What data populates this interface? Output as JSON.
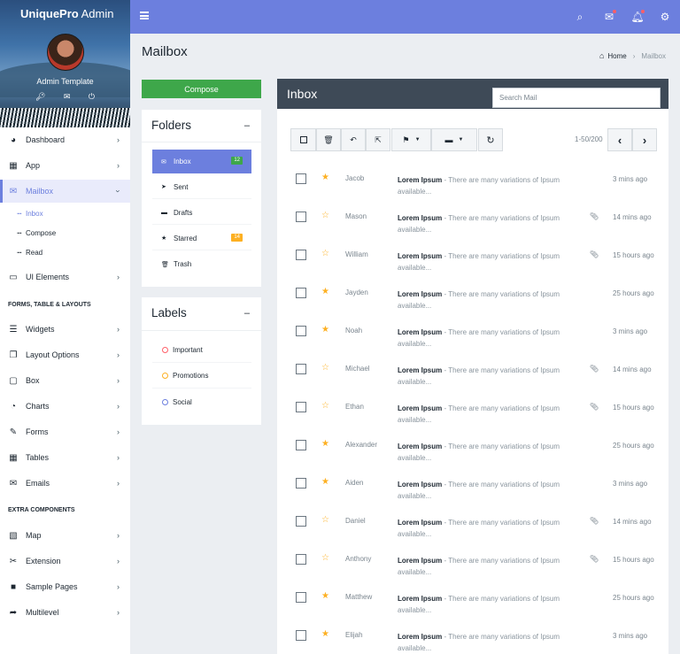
{
  "brand": {
    "bold": "UniquePro",
    "rest": " Admin"
  },
  "profile": {
    "name": "Admin Template"
  },
  "sidebar": {
    "items": [
      {
        "label": "Dashboard"
      },
      {
        "label": "App"
      },
      {
        "label": "Mailbox"
      },
      {
        "label": "UI Elements"
      },
      {
        "label": "Widgets"
      },
      {
        "label": "Layout Options"
      },
      {
        "label": "Box"
      },
      {
        "label": "Charts"
      },
      {
        "label": "Forms"
      },
      {
        "label": "Tables"
      },
      {
        "label": "Emails"
      },
      {
        "label": "Map"
      },
      {
        "label": "Extension"
      },
      {
        "label": "Sample Pages"
      },
      {
        "label": "Multilevel"
      }
    ],
    "mailbox_sub": [
      {
        "label": "Inbox"
      },
      {
        "label": "Compose"
      },
      {
        "label": "Read"
      }
    ],
    "headers": {
      "forms": "FORMS, TABLE & LAYOUTS",
      "extra": "EXTRA COMPONENTS"
    }
  },
  "page": {
    "title": "Mailbox"
  },
  "breadcrumb": {
    "home": "Home",
    "current": "Mailbox"
  },
  "compose": {
    "label": "Compose"
  },
  "folders": {
    "title": "Folders",
    "items": [
      {
        "label": "Inbox",
        "count": "12"
      },
      {
        "label": "Sent"
      },
      {
        "label": "Drafts"
      },
      {
        "label": "Starred",
        "count": "14"
      },
      {
        "label": "Trash"
      }
    ]
  },
  "labels": {
    "title": "Labels",
    "items": [
      {
        "label": "Important",
        "color": "#ff5f68"
      },
      {
        "label": "Promotions",
        "color": "#fdb022"
      },
      {
        "label": "Social",
        "color": "#6c7fde"
      }
    ]
  },
  "inbox": {
    "title": "Inbox",
    "search_placeholder": "Search Mail",
    "pager": "1-50/200",
    "colors": {
      "accent": "#6c7fde",
      "star": "#fdb022",
      "header": "#3e4a57",
      "green": "#3ea74a"
    },
    "rows": [
      {
        "from": "Jacob",
        "subject": "Lorem Ipsum",
        "preview": " - There are many variations of Ipsum available...",
        "time": "3 mins ago",
        "starred": true,
        "attach": false
      },
      {
        "from": "Mason",
        "subject": "Lorem Ipsum",
        "preview": " - There are many variations of Ipsum available...",
        "time": "14 mins ago",
        "starred": false,
        "attach": true
      },
      {
        "from": "William",
        "subject": "Lorem Ipsum",
        "preview": " - There are many variations of Ipsum available...",
        "time": "15 hours ago",
        "starred": false,
        "attach": true
      },
      {
        "from": "Jayden",
        "subject": "Lorem Ipsum",
        "preview": " - There are many variations of Ipsum available...",
        "time": "25 hours ago",
        "starred": true,
        "attach": false
      },
      {
        "from": "Noah",
        "subject": "Lorem Ipsum",
        "preview": " - There are many variations of Ipsum available...",
        "time": "3 mins ago",
        "starred": true,
        "attach": false
      },
      {
        "from": "Michael",
        "subject": "Lorem Ipsum",
        "preview": " - There are many variations of Ipsum available...",
        "time": "14 mins ago",
        "starred": false,
        "attach": true
      },
      {
        "from": "Ethan",
        "subject": "Lorem Ipsum",
        "preview": " - There are many variations of Ipsum available...",
        "time": "15 hours ago",
        "starred": false,
        "attach": true
      },
      {
        "from": "Alexander",
        "subject": "Lorem Ipsum",
        "preview": " - There are many variations of Ipsum available...",
        "time": "25 hours ago",
        "starred": true,
        "attach": false
      },
      {
        "from": "Aiden",
        "subject": "Lorem Ipsum",
        "preview": " - There are many variations of Ipsum available...",
        "time": "3 mins ago",
        "starred": true,
        "attach": false
      },
      {
        "from": "Daniel",
        "subject": "Lorem Ipsum",
        "preview": " - There are many variations of Ipsum available...",
        "time": "14 mins ago",
        "starred": false,
        "attach": true
      },
      {
        "from": "Anthony",
        "subject": "Lorem Ipsum",
        "preview": " - There are many variations of Ipsum available...",
        "time": "15 hours ago",
        "starred": false,
        "attach": true
      },
      {
        "from": "Matthew",
        "subject": "Lorem Ipsum",
        "preview": " - There are many variations of Ipsum available...",
        "time": "25 hours ago",
        "starred": true,
        "attach": false
      },
      {
        "from": "Elijah",
        "subject": "Lorem Ipsum",
        "preview": " - There are many variations of Ipsum available...",
        "time": "3 mins ago",
        "starred": true,
        "attach": false
      }
    ]
  }
}
